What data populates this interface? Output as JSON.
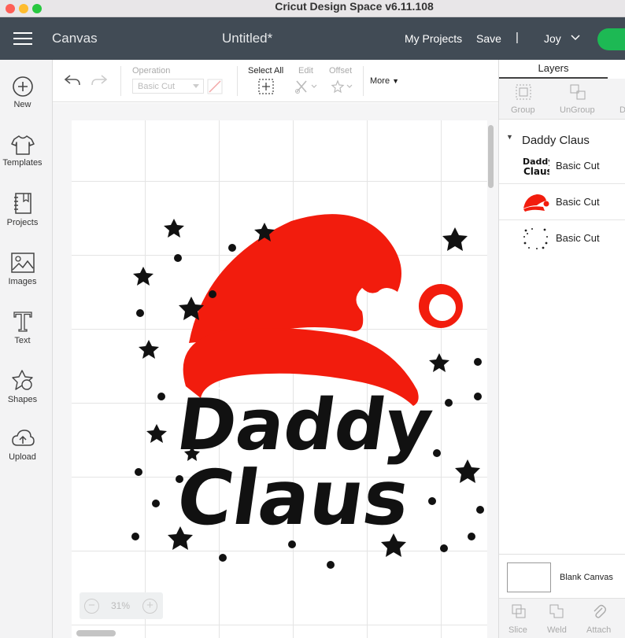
{
  "window": {
    "title": "Cricut Design Space  v6.11.108"
  },
  "header": {
    "canvas": "Canvas",
    "doc_title": "Untitled*",
    "my_projects": "My Projects",
    "save": "Save",
    "separator": "|",
    "user": "Joy"
  },
  "sidebar": {
    "items": [
      {
        "label": "New",
        "icon": "plus-circle-icon"
      },
      {
        "label": "Templates",
        "icon": "tshirt-icon"
      },
      {
        "label": "Projects",
        "icon": "notebook-icon"
      },
      {
        "label": "Images",
        "icon": "image-icon"
      },
      {
        "label": "Text",
        "icon": "text-icon"
      },
      {
        "label": "Shapes",
        "icon": "shapes-icon"
      },
      {
        "label": "Upload",
        "icon": "cloud-upload-icon"
      }
    ]
  },
  "toolbar": {
    "operation_label": "Operation",
    "operation_value": "Basic Cut",
    "select_all": "Select All",
    "edit": "Edit",
    "offset": "Offset",
    "more": "More"
  },
  "canvas": {
    "zoom": "31%",
    "design_text_line1": "Daddy",
    "design_text_line2": "Claus"
  },
  "layers": {
    "tab": "Layers",
    "tools": [
      "Group",
      "UnGroup",
      "D"
    ],
    "group_name": "Daddy Claus",
    "rows": [
      {
        "label": "Basic Cut",
        "thumb": "daddy-claus-text"
      },
      {
        "label": "Basic Cut",
        "thumb": "santa-hat"
      },
      {
        "label": "Basic Cut",
        "thumb": "star-dots-circle"
      }
    ],
    "blank_canvas": "Blank Canvas",
    "actions": [
      "Slice",
      "Weld",
      "Attach"
    ]
  },
  "colors": {
    "header_bg": "#414b55",
    "hat_red": "#f21c0d",
    "make_green": "#1db954"
  }
}
